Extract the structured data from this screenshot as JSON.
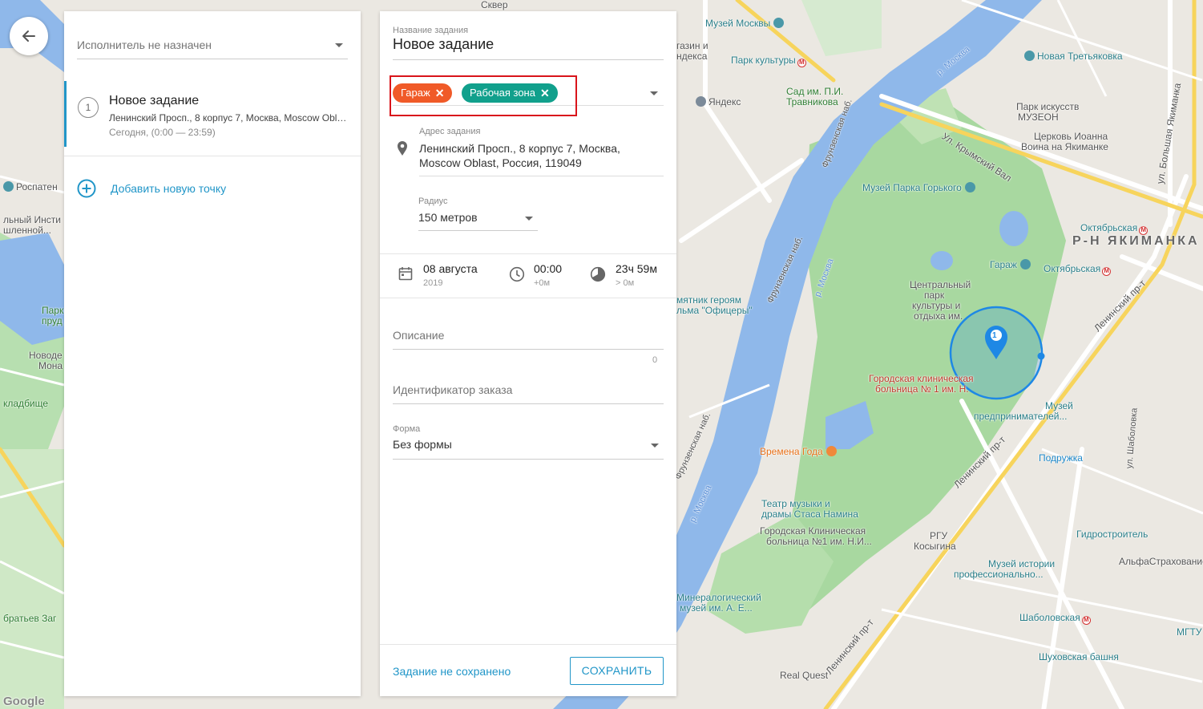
{
  "colors": {
    "accent": "#2196c8",
    "tag_garage": "#f05a28",
    "tag_workzone": "#11a08c",
    "highlight_box": "#d9141b",
    "geofence": "#1e88e5"
  },
  "back_button": {
    "icon": "arrow-left-icon"
  },
  "left_panel": {
    "assignee_placeholder": "Исполнитель не назначен",
    "task": {
      "number": "1",
      "title": "Новое задание",
      "address": "Ленинский Просп., 8 корпус 7, Москва, Moscow Oblast, Россия, 119049",
      "time": "Сегодня, (0:00 — 23:59)"
    },
    "add_point_label": "Добавить новую точку"
  },
  "edit_panel": {
    "name_label": "Название задания",
    "name_value": "Новое задание",
    "tags": [
      {
        "label": "Гараж"
      },
      {
        "label": "Рабочая зона"
      }
    ],
    "address_label": "Адрес задания",
    "address_line1": "Ленинский Просп., 8 корпус 7, Москва,",
    "address_line2": "Moscow Oblast, Россия, 119049",
    "radius_label": "Радиус",
    "radius_value": "150 метров",
    "date_main": "08 августа",
    "date_sub": "2019",
    "start_main": "00:00",
    "start_sub": "+0м",
    "duration_main": "23ч 59м",
    "duration_sub": "> 0м",
    "description_placeholder": "Описание",
    "description_counter": "0",
    "order_id_placeholder": "Идентификатор заказа",
    "form_label": "Форма",
    "form_value": "Без формы",
    "status_text": "Задание не сохранено",
    "save_label": "СОХРАНИТЬ"
  },
  "map": {
    "marker_number": "1",
    "labels": {
      "museum_moscow": "Музей Москвы",
      "park_kultury": "Парк культуры",
      "new_tretyakov": "Новая Третьяковка",
      "yandex": "Яндекс",
      "sad_travnikov_1": "Сад им. П.И.",
      "sad_travnikov_2": "Травникова",
      "muzeon_1": "Парк искусств",
      "muzeon_2": "МУЗЕОН",
      "church_1": "Церковь Иоанна",
      "church_2": "Воина на Якиманке",
      "gorky_museum": "Музей Парка Горького",
      "oktyabrskaya_1": "Октябрьская",
      "yakimanka": "Р-Н ЯКИМАНКА",
      "garage": "Гараж",
      "oktyabrskaya_2": "Октябрьская",
      "central_park_1": "Центральный",
      "central_park_2": "парк",
      "central_park_3": "культуры и",
      "central_park_4": "отдыха им.",
      "hospital1_1": "Городская клиническая",
      "hospital1_2": "больница № 1 им. Н.",
      "entrepreneurs_1": "Музей",
      "entrepreneurs_2": "предпринимателей...",
      "officers_1": "мятник героям",
      "officers_2": "льма \"Офицеры\"",
      "vremena_goda": "Времена Года",
      "podruzhka": "Подружка",
      "namin_1": "Театр музыки и",
      "namin_2": "драмы Стаса Намина",
      "hospital_nr1_1": "Городская Клиническая",
      "hospital_nr1_2": "больница №1 им. Н.И...",
      "rgu_1": "РГУ",
      "rgu_2": "Косыгина",
      "gidrostroitel": "Гидростроитель",
      "alfa": "АльфаСтрахование",
      "prof_edu_1": "Музей истории",
      "prof_edu_2": "профессионально...",
      "mineral_1": "Минералогический",
      "mineral_2": "музей им. А. Е...",
      "shabolovskaya": "Шаболовская",
      "mgtu": "МГТУ",
      "shukhov": "Шуховская башня",
      "real_quest": "Real Quest",
      "rospatent": "Роспатен",
      "left_inst_1": "льный Инсти",
      "left_inst_2": "шленной...",
      "neskuchny_1": "Парк",
      "neskuchny_2": "пруд",
      "novodevichy_1": "Новоде",
      "novodevichy_2": "Мона",
      "kladbische": "кладбище",
      "bratiev": "братьев Заг",
      "river_1": "р. Москва",
      "river_2": "р. Москва",
      "river_3": "р. Москва",
      "krymsky_val": "Ул. Крымский Вал",
      "leninsky_1": "Ленинский пр-т",
      "leninsky_2": "Ленинский пр-т",
      "leninsky_3": "Ленинский пр-т",
      "bolshaya_yakimanka": "ул. Большая Якиманка",
      "frunzenskaya_1": "Фрунзенская наб.",
      "frunzenskaya_2": "Фрунзенская наб.",
      "frunzenskaya_3": "Фрунзенская наб.",
      "shabolovka": "ул. Шаболовка",
      "skver": "Сквер",
      "gazin_1": "газин и",
      "gazin_2": "ндекса",
      "google": "Google"
    }
  }
}
